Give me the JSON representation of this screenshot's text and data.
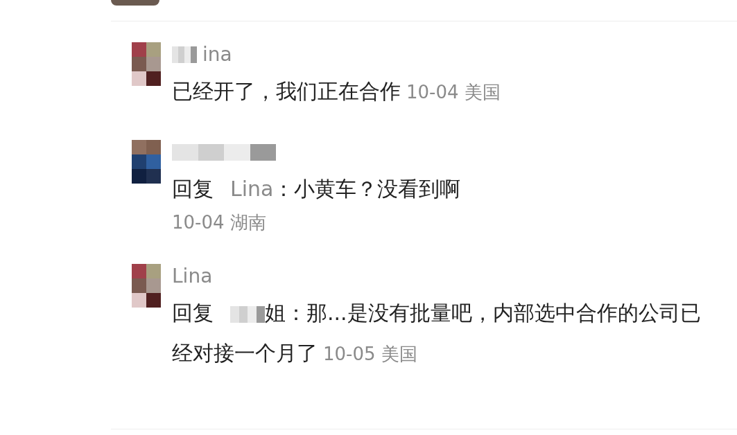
{
  "comments": [
    {
      "kind": "comment",
      "name": "ina",
      "name_blurred": true,
      "text": "已经开了，我们正在合作",
      "meta": "10-04 美国",
      "meta_inline": true
    },
    {
      "kind": "reply",
      "name_blurred": true,
      "reply_label": "回复",
      "reply_to": "Lina",
      "reply_blurred": false,
      "text": "：小黄车？没看到啊",
      "meta": "10-04 湖南",
      "meta_inline": false
    },
    {
      "kind": "reply",
      "name": "Lina",
      "name_blurred": false,
      "reply_label": "回复",
      "reply_to": "姐",
      "reply_blurred": true,
      "text": "：那...是没有批量吧，内部选中合作的公司已经对接一个月了",
      "meta": "10-05 美国",
      "meta_inline": true
    }
  ]
}
